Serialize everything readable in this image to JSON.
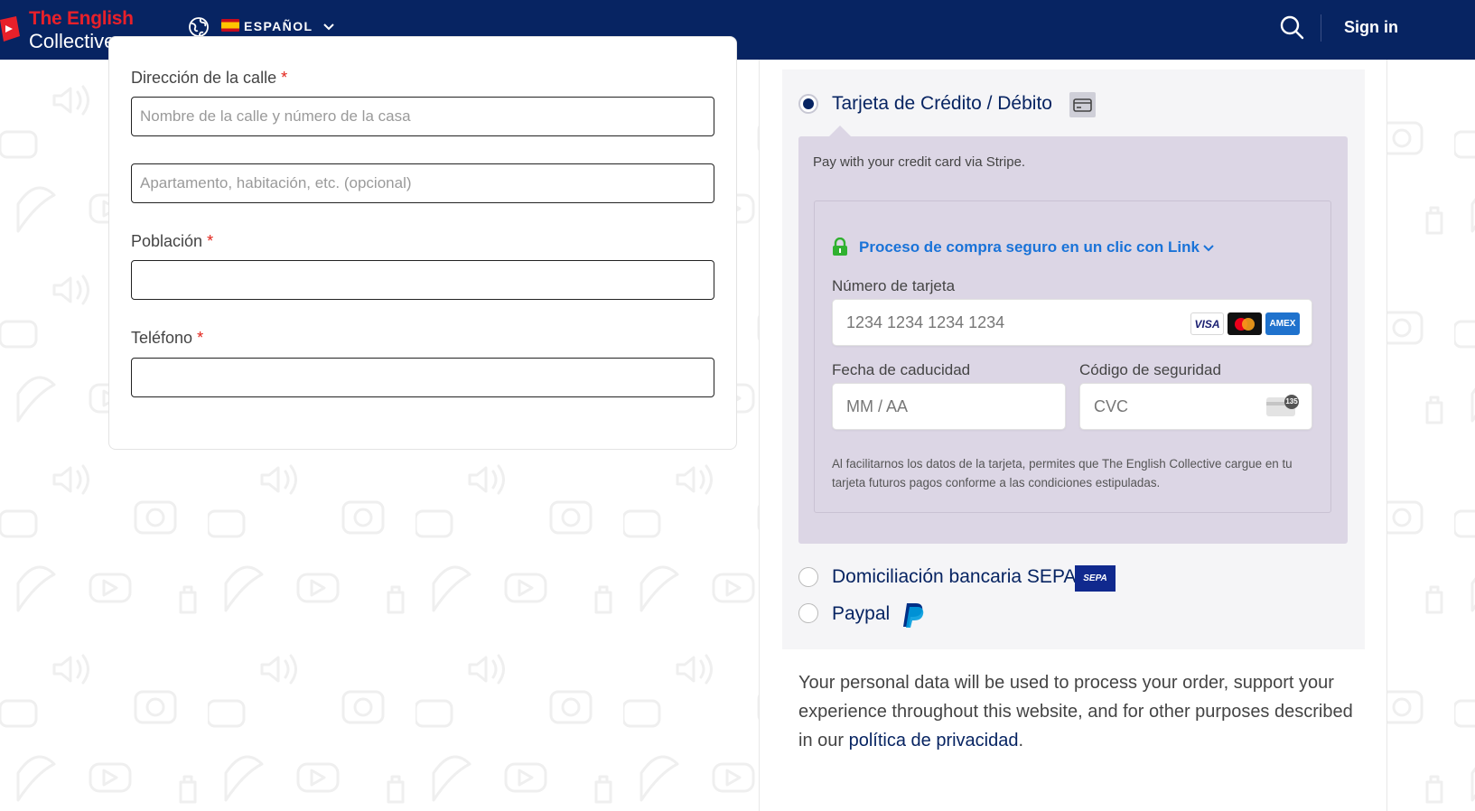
{
  "header": {
    "logo_line1": "The English",
    "logo_line2": "Collective",
    "language_label": "ESPAÑOL",
    "signin_label": "Sign in",
    "icons": [
      "globe-icon",
      "spain-flag-icon",
      "chevron-down-icon",
      "search-icon"
    ],
    "background_color": "#072462"
  },
  "address_form": {
    "street_label": "Dirección de la calle",
    "required_mark": "*",
    "street_placeholder": "Nombre de la calle y número de la casa",
    "street_value": "",
    "apartment_placeholder": "Apartamento, habitación, etc. (opcional)",
    "apartment_value": "",
    "city_label": "Población",
    "city_value": "",
    "phone_label": "Teléfono",
    "phone_value": ""
  },
  "payment": {
    "card_option_label": "Tarjeta de Crédito / Débito",
    "card_option_selected": true,
    "stripe_note": "Pay with your credit card via Stripe.",
    "link_text": "Proceso de compra seguro en un clic con Link",
    "card_number_label": "Número de tarjeta",
    "card_number_placeholder": "1234 1234 1234 1234",
    "card_brands": [
      "VISA",
      "Mastercard",
      "AMEX"
    ],
    "expiry_label": "Fecha de caducidad",
    "expiry_placeholder": "MM / AA",
    "cvc_label": "Código de seguridad",
    "cvc_placeholder": "CVC",
    "cvc_badge": "135",
    "legal_text": "Al facilitarnos los datos de la tarjeta, permites que The English Collective cargue en tu tarjeta futuros pagos conforme a las condiciones estipuladas.",
    "sepa_option_label": "Domiciliación bancaria SEPA",
    "sepa_badge": "SEPA",
    "paypal_option_label": "Paypal",
    "accent_color": "#1a73d8"
  },
  "privacy": {
    "text": "Your personal data will be used to process your order, support your experience throughout this website, and for other purposes described in our",
    "link_text": "política de privacidad",
    "suffix": "."
  }
}
